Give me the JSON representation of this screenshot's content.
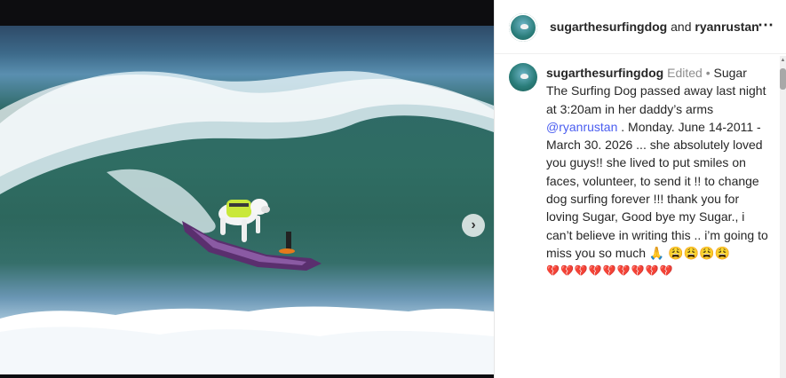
{
  "header": {
    "username": "sugarthesurfingdog",
    "connector": " and ",
    "collaborator": "ryanrustan",
    "more_icon": "⋯"
  },
  "media": {
    "next_icon": "›"
  },
  "caption": {
    "username": "sugarthesurfingdog",
    "edited": "Edited",
    "dot": " •",
    "text_before": "Sugar The Surfing Dog passed away last night at 3:20am in her daddy’s arms ",
    "mention": "@ryanrustan",
    "text_after": " . Monday. June 14-2011 - March 30. 2026 ... she absolutely loved you guys!! she lived to put smiles on faces, volunteer, to send it !! to change dog surfing forever !!! thank you for loving Sugar, Good bye my Sugar., i can’t believe in writing this .. i’m going to miss you so much 🙏 😩😩😩😩",
    "hearts": "💔💔💔💔💔💔💔💔💔"
  },
  "colors": {
    "mention": "#4a5df0",
    "text": "#262626",
    "meta": "#8e8e8e"
  }
}
